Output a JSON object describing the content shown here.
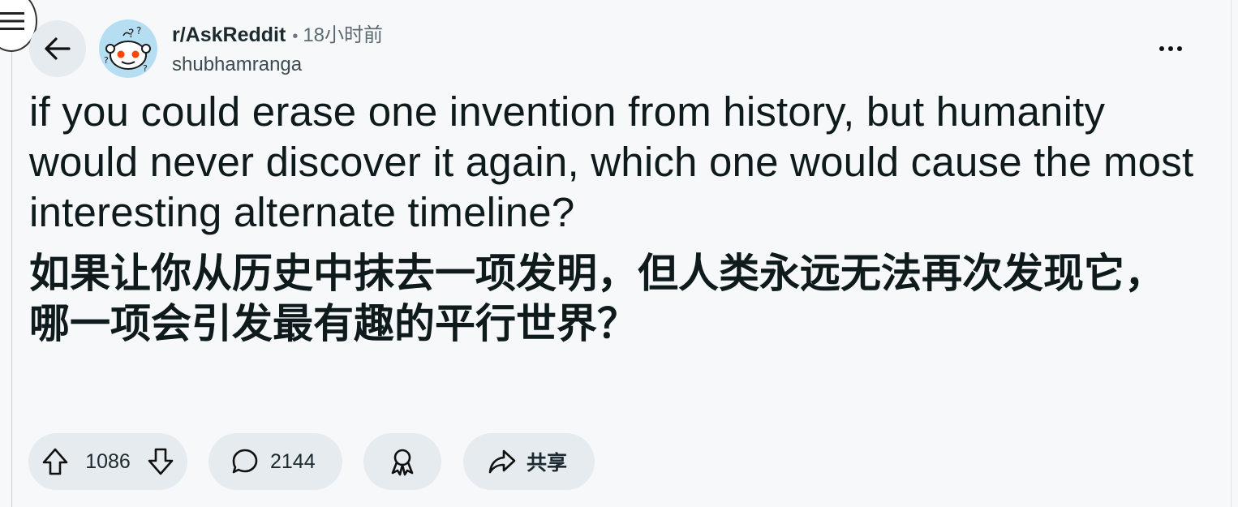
{
  "post": {
    "subreddit": "r/AskReddit",
    "separator": "•",
    "time": "18小时前",
    "author": "shubhamranga",
    "title_en": "if you could erase one invention from history, but humanity would never discover it again, which one would cause the most interesting alternate timeline?",
    "title_zh": "如果让你从历史中抹去一项发明，但人类永远无法再次发现它，哪一项会引发最有趣的平行世界？"
  },
  "actions": {
    "votes": "1086",
    "comments": "2144",
    "share_label": "共享"
  },
  "icons": {
    "menu": "hamburger-menu-icon",
    "back": "arrow-left-icon",
    "more": "more-horizontal-icon",
    "upvote": "upvote-arrow-icon",
    "downvote": "downvote-arrow-icon",
    "comment": "speech-bubble-icon",
    "award": "award-ribbon-icon",
    "share": "share-arrow-icon"
  },
  "colors": {
    "background": "#f7f8fa",
    "pill": "#e5ebee",
    "text": "#0f1a1c",
    "avatar_bg": "#b6def3"
  }
}
